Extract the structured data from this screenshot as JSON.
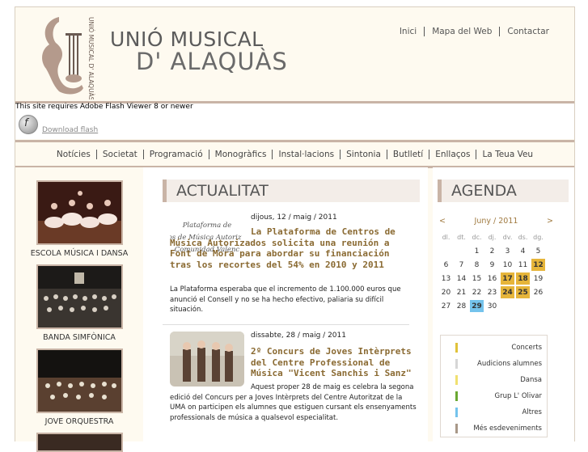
{
  "header": {
    "title_line1": "UNIÓ MUSICAL",
    "title_line2": "D' ALAQUÀS",
    "logo_vertical_text": "UNIÓ MUSICAL D' ALAQUÀS",
    "topnav": [
      "Inici",
      "Mapa del Web",
      "Contactar"
    ]
  },
  "flash": {
    "notice": "This site requires Adobe Flash Viewer 8 or newer",
    "link": "Download flash"
  },
  "mainnav": [
    "Notícies",
    "Societat",
    "Programació",
    "Monogràfics",
    "Instal·lacions",
    "Sintonia",
    "Butlletí",
    "Enllaços",
    "La Teua Veu"
  ],
  "sections": [
    {
      "label": "ESCOLA MÚSICA I DANSA"
    },
    {
      "label": "BANDA SIMFÒNICA"
    },
    {
      "label": "JOVE ORQUESTRA"
    }
  ],
  "news_heading": "ACTUALITAT",
  "news": [
    {
      "image_text": [
        "Plataforma de",
        "ros de Música Autoriz",
        "Comunidad Valenc"
      ],
      "date": "dijous, 12 / maig / 2011",
      "title": "La Plataforma de Centros de Música Autorizados solicita una reunión a Font de Mora para abordar su financiación tras los recortes del 54% en 2010 y 2011",
      "body": "La Plataforma esperaba que el incremento de 1.100.000 euros que anunció el Consell y no se ha hecho efectivo, paliaria su difícil situación."
    },
    {
      "date": "dissabte, 28 / maig / 2011",
      "title": "2º Concurs de Joves Intèrprets del Centre Professional de Música \"Vicent Sanchis i Sanz\"",
      "body": "Aquest proper 28 de maig es celebra la segona edició del Concurs per a Joves Intèrprets del Centre Autoritzat de la UMA on participen els alumnes que estiguen cursant els ensenyaments professionals de música a qualsevol especialitat."
    }
  ],
  "agenda": {
    "heading": "AGENDA",
    "prev": "<",
    "next": ">",
    "month": "Juny / 2011",
    "dow": [
      "dl.",
      "dt.",
      "dc.",
      "dj.",
      "dv.",
      "ds.",
      "dg."
    ],
    "weeks": [
      [
        "",
        "",
        "1",
        "2",
        "3",
        "4",
        "5"
      ],
      [
        "6",
        "7",
        "8",
        "9",
        "10",
        "11",
        "12"
      ],
      [
        "13",
        "14",
        "15",
        "16",
        "17",
        "18",
        "19"
      ],
      [
        "20",
        "21",
        "22",
        "23",
        "24",
        "25",
        "26"
      ],
      [
        "27",
        "28",
        "29",
        "30",
        "",
        "",
        ""
      ]
    ],
    "legend": [
      {
        "label": "Concerts",
        "color": "#e0c23a"
      },
      {
        "label": "Audicions alumnes",
        "color": "#d6d6d6"
      },
      {
        "label": "Dansa",
        "color": "#f0e070"
      },
      {
        "label": "Grup L' Olivar",
        "color": "#6aa832"
      },
      {
        "label": "Altres",
        "color": "#74c3ec"
      },
      {
        "label": "Més esdeveniments",
        "color": "#a89888"
      }
    ]
  }
}
